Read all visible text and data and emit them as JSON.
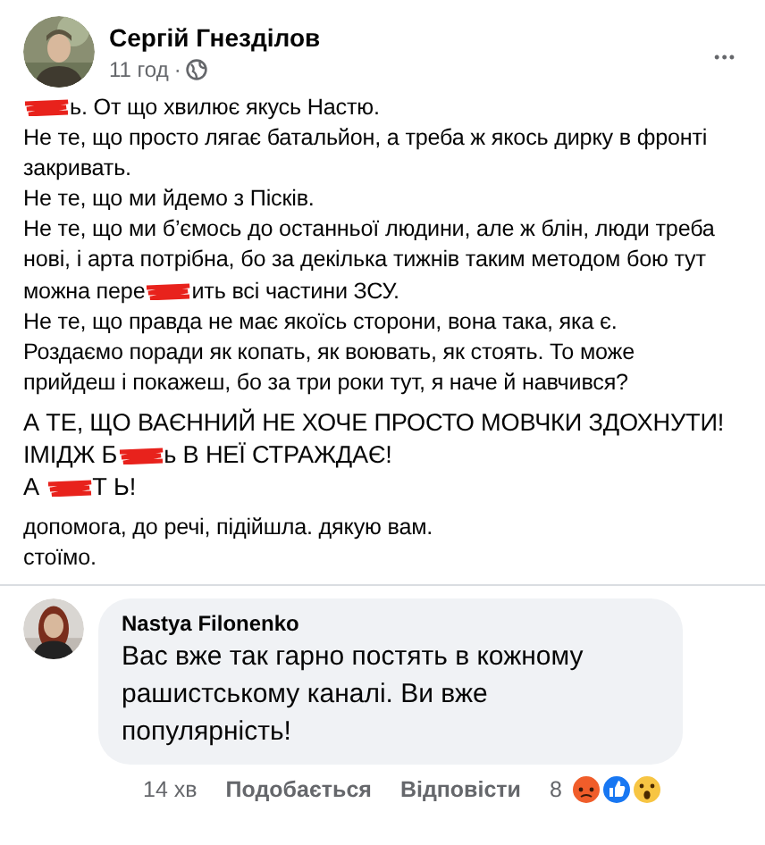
{
  "post": {
    "author": "Сергій Гнезділов",
    "time": "11 год",
    "separator": "·",
    "menu": "•••",
    "paragraphs": [
      {
        "kind": "normal",
        "lines": [
          {
            "segments": [
              {
                "kind": "censored"
              },
              {
                "kind": "text",
                "text": "ь. От що хвилює якусь Настю."
              }
            ]
          },
          {
            "segments": [
              {
                "kind": "text",
                "text": "Не те, що просто лягає батальйон, а треба ж якось дирку в фронті закривать."
              }
            ]
          },
          {
            "segments": [
              {
                "kind": "text",
                "text": "Не те, що ми йдемо з Пісків."
              }
            ]
          },
          {
            "segments": [
              {
                "kind": "text",
                "text": "Не те, що ми б’ємось до останньої людини, але ж блін, люди треба нові, і арта потрібна, бо за декілька тижнів таким методом бою тут можна пере"
              },
              {
                "kind": "censored"
              },
              {
                "kind": "text",
                "text": "ить всі частини ЗСУ."
              }
            ]
          },
          {
            "segments": [
              {
                "kind": "text",
                "text": "Не те, що правда не має якоїсь сторони, вона така, яка є."
              }
            ]
          },
          {
            "segments": [
              {
                "kind": "text",
                "text": "Роздаємо поради як копать, як воювать, як стоять. То може прийдеш і покажеш, бо за три роки тут, я наче й навчився?"
              }
            ]
          }
        ]
      },
      {
        "kind": "emphasis",
        "lines": [
          {
            "segments": [
              {
                "kind": "text",
                "text": "А ТЕ, ЩО ВАЄННИЙ НЕ ХОЧЕ ПРОСТО МОВЧКИ ЗДОХНУТИ! ІМІДЖ Б"
              },
              {
                "kind": "censored"
              },
              {
                "kind": "text",
                "text": "ь В НЕЇ СТРАЖДАЄ!"
              }
            ]
          },
          {
            "segments": [
              {
                "kind": "text",
                "text": "А "
              },
              {
                "kind": "censored"
              },
              {
                "kind": "text",
                "text": "Т Ь!"
              }
            ]
          }
        ]
      },
      {
        "kind": "normal",
        "lines": [
          {
            "segments": [
              {
                "kind": "text",
                "text": "допомога, до речі, підійшла. дякую вам."
              }
            ]
          },
          {
            "segments": [
              {
                "kind": "text",
                "text": "стоїмо."
              }
            ]
          }
        ]
      }
    ]
  },
  "comment": {
    "author": "Nastya Filonenko",
    "text": "Вас вже так гарно постять в кожному рашистському каналі. Ви вже популярність!",
    "time": "14 хв",
    "actions": [
      "Подобається",
      "Відповісти"
    ],
    "reaction_count": "8",
    "reactions": [
      {
        "kind": "angry"
      },
      {
        "kind": "like"
      },
      {
        "kind": "wow"
      }
    ]
  }
}
